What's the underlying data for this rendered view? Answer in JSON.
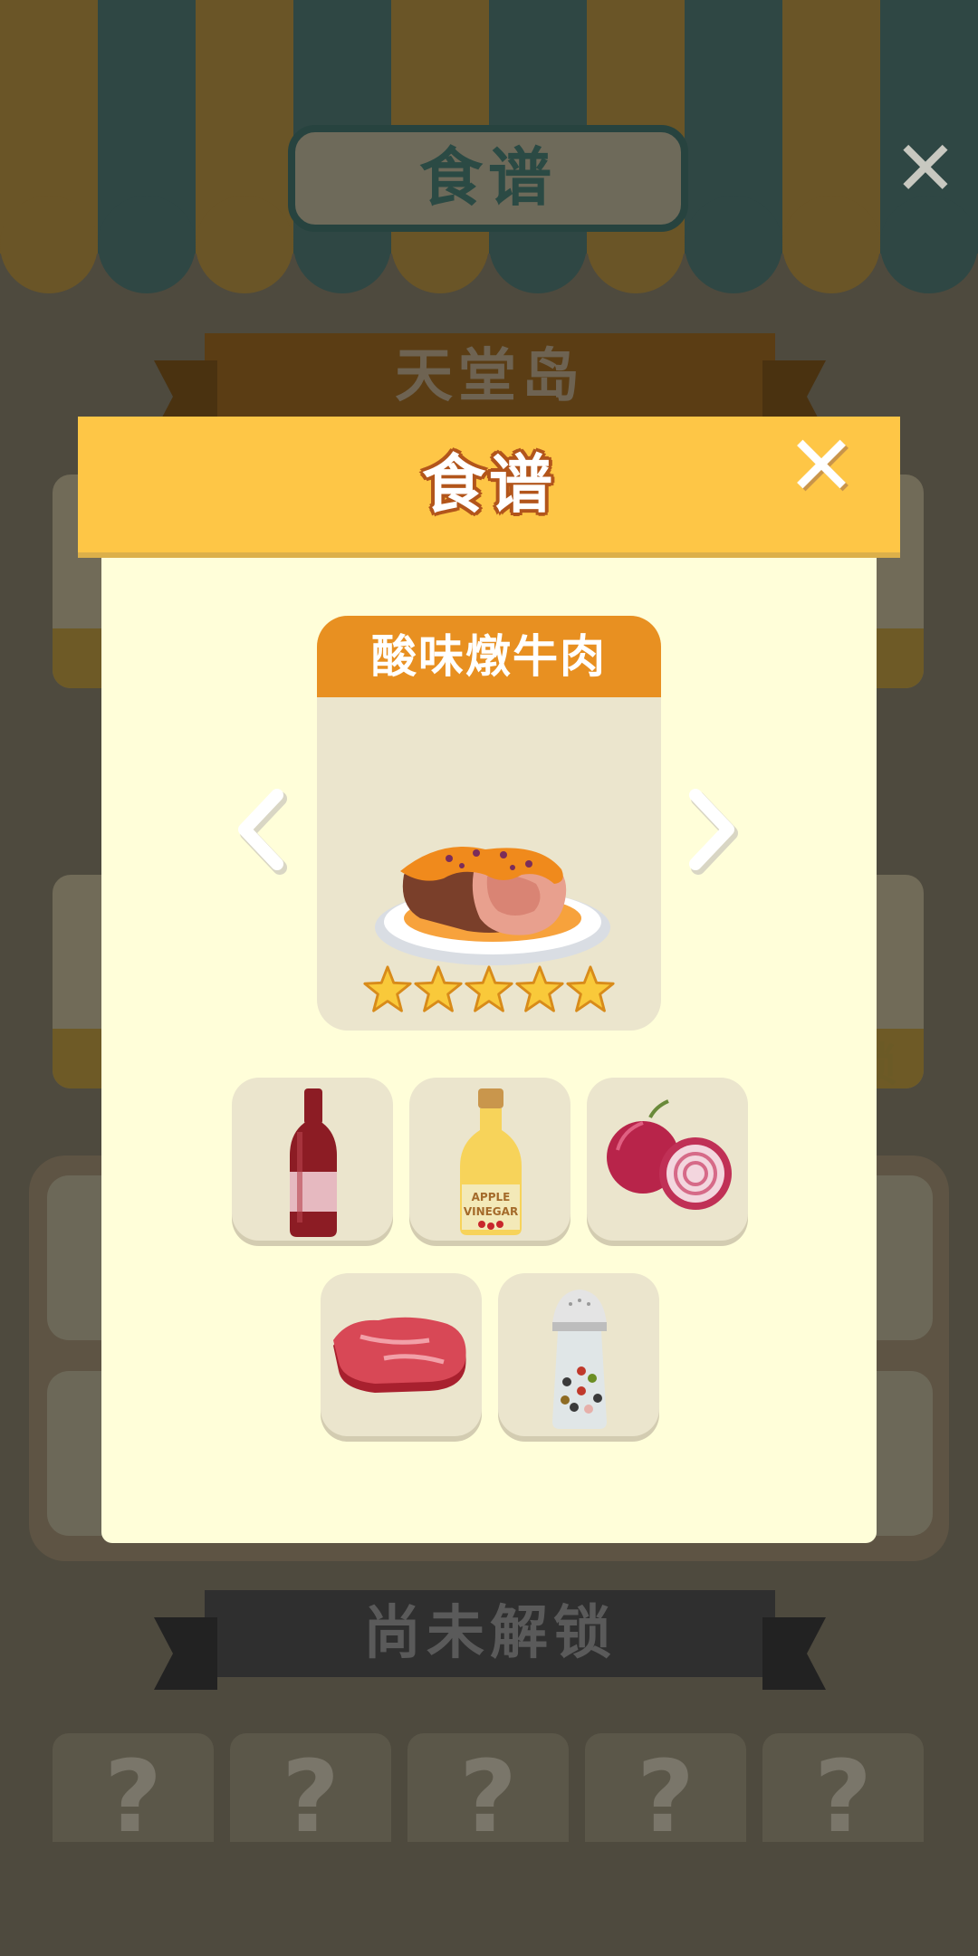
{
  "background": {
    "title": "食谱",
    "close_glyph": "✕",
    "section_unlocked": "天堂岛",
    "section_locked": "尚未解锁",
    "lock_tile_glyph": "?",
    "partial_lock_text": "锁"
  },
  "modal": {
    "title": "食谱",
    "close_glyph": "✕",
    "dish": {
      "name": "酸味燉牛肉",
      "rating": 5,
      "max_rating": 5
    },
    "ingredients": [
      {
        "name": "red-wine",
        "icon": "wine-bottle-icon"
      },
      {
        "name": "apple-vinegar",
        "icon": "vinegar-bottle-icon",
        "label_line1": "APPLE",
        "label_line2": "VINEGAR"
      },
      {
        "name": "red-onion",
        "icon": "onion-icon"
      },
      {
        "name": "beef-steak",
        "icon": "steak-icon"
      },
      {
        "name": "pepper",
        "icon": "pepper-grinder-icon"
      }
    ]
  },
  "colors": {
    "header": "#fec646",
    "dish_name_bar": "#e89021",
    "modal_body": "#fffed9",
    "card": "#ebe5cd"
  }
}
